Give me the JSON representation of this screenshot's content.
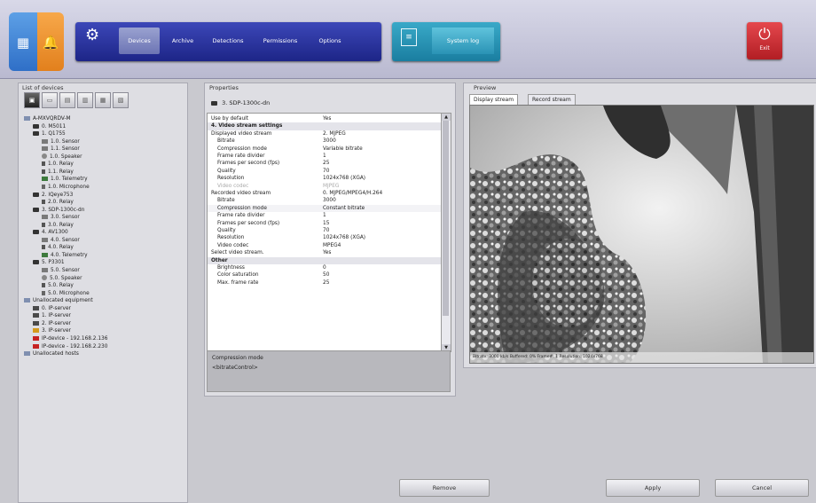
{
  "quick_buttons": [
    {
      "icon": "grid-icon",
      "color": "#3a7fd6"
    },
    {
      "icon": "bell-icon",
      "color": "#ee9233"
    }
  ],
  "nav": {
    "tabs": [
      {
        "label": "Devices",
        "active": true
      },
      {
        "label": "Archive",
        "active": false
      },
      {
        "label": "Detections",
        "active": false
      },
      {
        "label": "Permissions",
        "active": false
      },
      {
        "label": "Options",
        "active": false
      }
    ],
    "system_log_label": "System log",
    "exit_label": "Exit"
  },
  "devices": {
    "title": "List of devices",
    "tree": [
      {
        "label": "A-MXVQRDV-M",
        "icon": "folder",
        "depth": 0
      },
      {
        "label": "0. M5011",
        "icon": "cam",
        "depth": 1
      },
      {
        "label": "1. Q1755",
        "icon": "cam",
        "depth": 1
      },
      {
        "label": "1.0. Sensor",
        "icon": "sens",
        "depth": 2
      },
      {
        "label": "1.1. Sensor",
        "icon": "sens",
        "depth": 2
      },
      {
        "label": "1.0. Speaker",
        "icon": "spk",
        "depth": 2
      },
      {
        "label": "1.0. Relay",
        "icon": "relay",
        "depth": 2
      },
      {
        "label": "1.1. Relay",
        "icon": "relay",
        "depth": 2
      },
      {
        "label": "1.0. Telemetry",
        "icon": "tele",
        "depth": 2
      },
      {
        "label": "1.0. Microphone",
        "icon": "mic",
        "depth": 2
      },
      {
        "label": "2. IQeye753",
        "icon": "cam",
        "depth": 1
      },
      {
        "label": "2.0. Relay",
        "icon": "relay",
        "depth": 2
      },
      {
        "label": "3. SDP-1300c-dn",
        "icon": "cam",
        "depth": 1
      },
      {
        "label": "3.0. Sensor",
        "icon": "sens",
        "depth": 2
      },
      {
        "label": "3.0. Relay",
        "icon": "relay",
        "depth": 2
      },
      {
        "label": "4. AV1300",
        "icon": "cam",
        "depth": 1
      },
      {
        "label": "4.0. Sensor",
        "icon": "sens",
        "depth": 2
      },
      {
        "label": "4.0. Relay",
        "icon": "relay",
        "depth": 2
      },
      {
        "label": "4.0. Telemetry",
        "icon": "tele",
        "depth": 2
      },
      {
        "label": "5. P3301",
        "icon": "cam",
        "depth": 1
      },
      {
        "label": "5.0. Sensor",
        "icon": "sens",
        "depth": 2
      },
      {
        "label": "5.0. Speaker",
        "icon": "spk",
        "depth": 2
      },
      {
        "label": "5.0. Relay",
        "icon": "relay",
        "depth": 2
      },
      {
        "label": "5.0. Microphone",
        "icon": "mic",
        "depth": 2
      },
      {
        "label": "Unallocated equipment",
        "icon": "folder",
        "depth": 0
      },
      {
        "label": "0. IP-server",
        "icon": "srv",
        "depth": 1
      },
      {
        "label": "1. IP-server",
        "icon": "srv",
        "depth": 1
      },
      {
        "label": "2. IP-server",
        "icon": "srv",
        "depth": 1
      },
      {
        "label": "3. IP-server",
        "icon": "cam-or",
        "depth": 1
      },
      {
        "label": "IP-device - 192.168.2.136",
        "icon": "cam-red",
        "depth": 1
      },
      {
        "label": "IP-device - 192.168.2.230",
        "icon": "cam-red",
        "depth": 1
      },
      {
        "label": "Unallocated hosts",
        "icon": "folder",
        "depth": 0
      }
    ]
  },
  "properties": {
    "title": "Properties",
    "device": "3. SDP-1300c-dn",
    "rows": [
      {
        "key": "Use by default",
        "value": "Yes",
        "type": "normal"
      },
      {
        "key": "4. Video stream settings",
        "value": "",
        "type": "sect"
      },
      {
        "key": "Displayed video stream",
        "value": "2. MJPEG",
        "type": "group"
      },
      {
        "key": "Bitrate",
        "value": "3000",
        "type": "ind"
      },
      {
        "key": "Compression mode",
        "value": "Variable bitrate",
        "type": "ind"
      },
      {
        "key": "Frame rate divider",
        "value": "1",
        "type": "ind"
      },
      {
        "key": "Frames per second (fps)",
        "value": "25",
        "type": "ind"
      },
      {
        "key": "Quality",
        "value": "70",
        "type": "ind"
      },
      {
        "key": "Resolution",
        "value": "1024x768 (XGA)",
        "type": "ind"
      },
      {
        "key": "Video codec",
        "value": "MJPEG",
        "type": "dim"
      },
      {
        "key": "Recorded video stream",
        "value": "0. MJPEG/MPEG4/H.264",
        "type": "group"
      },
      {
        "key": "Bitrate",
        "value": "3000",
        "type": "ind"
      },
      {
        "key": "Compression mode",
        "value": "Constant bitrate",
        "type": "indalt"
      },
      {
        "key": "Frame rate divider",
        "value": "1",
        "type": "ind"
      },
      {
        "key": "Frames per second (fps)",
        "value": "15",
        "type": "ind"
      },
      {
        "key": "Quality",
        "value": "70",
        "type": "ind"
      },
      {
        "key": "Resolution",
        "value": "1024x768 (XGA)",
        "type": "ind"
      },
      {
        "key": "Video codec",
        "value": "MPEG4",
        "type": "ind"
      },
      {
        "key": "Select video stream.",
        "value": "Yes",
        "type": "normal"
      },
      {
        "key": "Other",
        "value": "",
        "type": "sect"
      },
      {
        "key": "Brightness",
        "value": "0",
        "type": "ind"
      },
      {
        "key": "Color saturation",
        "value": "50",
        "type": "ind"
      },
      {
        "key": "Max. frame rate",
        "value": "25",
        "type": "ind"
      }
    ],
    "description_title": "Compression mode",
    "description_text": "<bitrateControl>"
  },
  "preview": {
    "title": "Preview",
    "tabs": [
      "Display stream",
      "Record stream"
    ],
    "status": "Bitrate: 3000 kb/s   Buffered: 0%   Frame#: 1   Resolution: 1024x768"
  },
  "buttons": {
    "remove": "Remove",
    "apply": "Apply",
    "cancel": "Cancel"
  }
}
